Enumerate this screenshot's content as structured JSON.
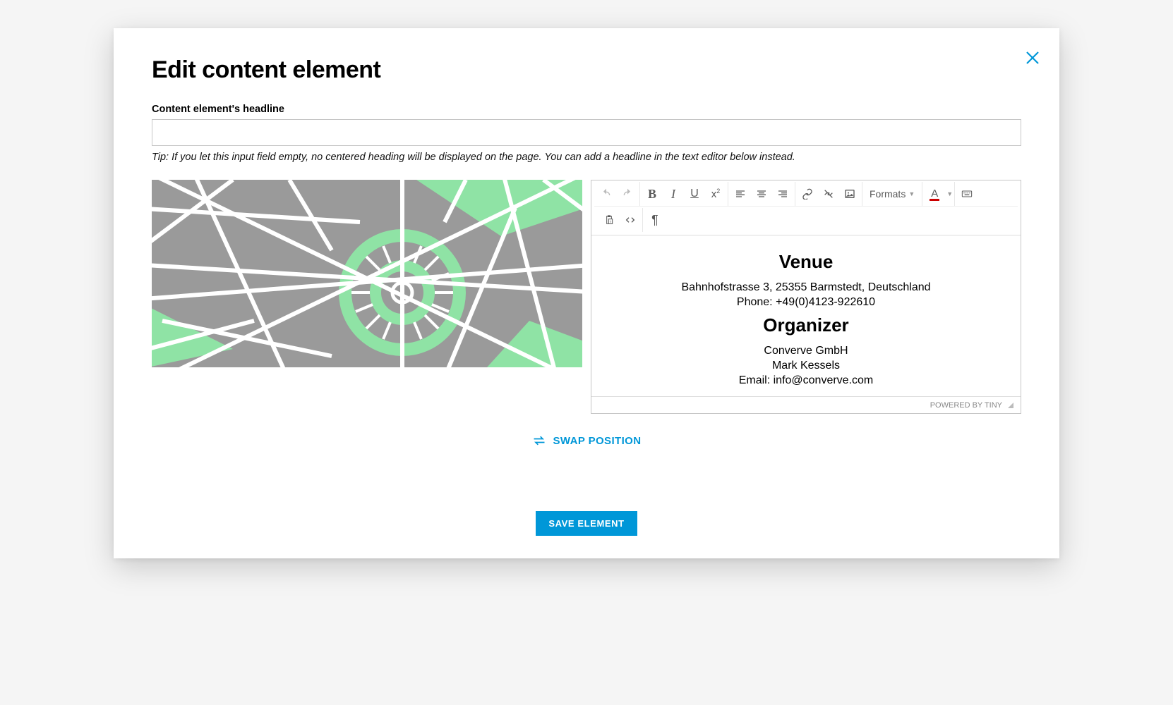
{
  "modal": {
    "title": "Edit content element",
    "close_label": "Close"
  },
  "field": {
    "label": "Content element's headline",
    "value": "",
    "tip": "Tip: If you let this input field empty, no centered heading will be displayed on the page. You can add a headline in the text editor below instead."
  },
  "toolbar": {
    "formats_label": "Formats"
  },
  "editor_content": {
    "heading1": "Venue",
    "line1": "Bahnhofstrasse 3, 25355 Barmstedt, Deutschland",
    "line2": "Phone: +49(0)4123-922610",
    "heading2": "Organizer",
    "line3": "Converve GmbH",
    "line4": "Mark Kessels",
    "line5": "Email: info@converve.com"
  },
  "statusbar": {
    "branding": "POWERED BY TINY"
  },
  "swap": {
    "label": "SWAP POSITION"
  },
  "actions": {
    "save_label": "SAVE ELEMENT"
  }
}
